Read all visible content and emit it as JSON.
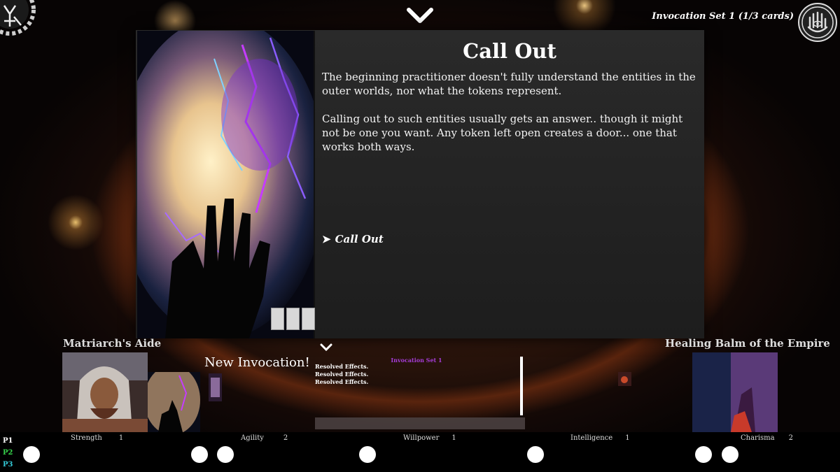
{
  "header": {
    "set_label": "Invocation Set  1 (1/3 cards)"
  },
  "card": {
    "title": "Call Out",
    "description": "The beginning practitioner doesn't fully understand the entities in the outer worlds, nor what the tokens represent.\n\nCalling out to such entities usually gets an answer.. though it might not be one you want. Any token left open creates a door... one that works both ways.",
    "action_label": "Call Out",
    "action_arrow": "➤",
    "slot_count": 3
  },
  "left_card": {
    "name": "Matriarch's Aide"
  },
  "right_card": {
    "name": "Healing Balm of the Empire"
  },
  "new_invocation": "New Invocation!",
  "log": {
    "title": "Invocation Set 1",
    "entries": [
      "Resolved Effects.",
      "Resolved Effects.",
      "Resolved Effects."
    ]
  },
  "players": [
    {
      "label": "P1",
      "color": "#ffffff"
    },
    {
      "label": "P2",
      "color": "#36d14a"
    },
    {
      "label": "P3",
      "color": "#33c9d6"
    }
  ],
  "stats": [
    {
      "name": "Strength",
      "value": "1"
    },
    {
      "name": "Agility",
      "value": "2"
    },
    {
      "name": "Willpower",
      "value": "1"
    },
    {
      "name": "Intelligence",
      "value": "1"
    },
    {
      "name": "Charisma",
      "value": "2"
    }
  ],
  "tokens": 8,
  "icons": {
    "top": "chevron-down-icon",
    "logo": "sigil-logo-icon",
    "menu": "eye-hand-icon"
  }
}
